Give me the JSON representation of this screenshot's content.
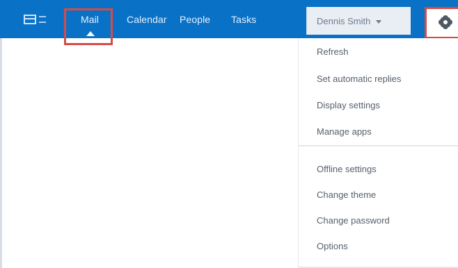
{
  "colors": {
    "topbar": "#0a72c6",
    "highlight": "#d74a47",
    "menu_text": "#55606d"
  },
  "header": {
    "tabs": [
      {
        "label": "Mail"
      },
      {
        "label": "Calendar"
      },
      {
        "label": "People"
      },
      {
        "label": "Tasks"
      }
    ],
    "user": {
      "name": "Dennis Smith"
    },
    "icons": {
      "app_launcher": "grid-icon",
      "settings": "gear-icon",
      "user_menu": "chevron-down-icon"
    }
  },
  "settings_menu": {
    "items": [
      {
        "label": "Refresh"
      },
      {
        "label": "Set automatic replies"
      },
      {
        "label": "Display settings"
      },
      {
        "label": "Manage apps"
      },
      {
        "label": "Offline settings"
      },
      {
        "label": "Change theme"
      },
      {
        "label": "Change password"
      },
      {
        "label": "Options"
      }
    ]
  }
}
